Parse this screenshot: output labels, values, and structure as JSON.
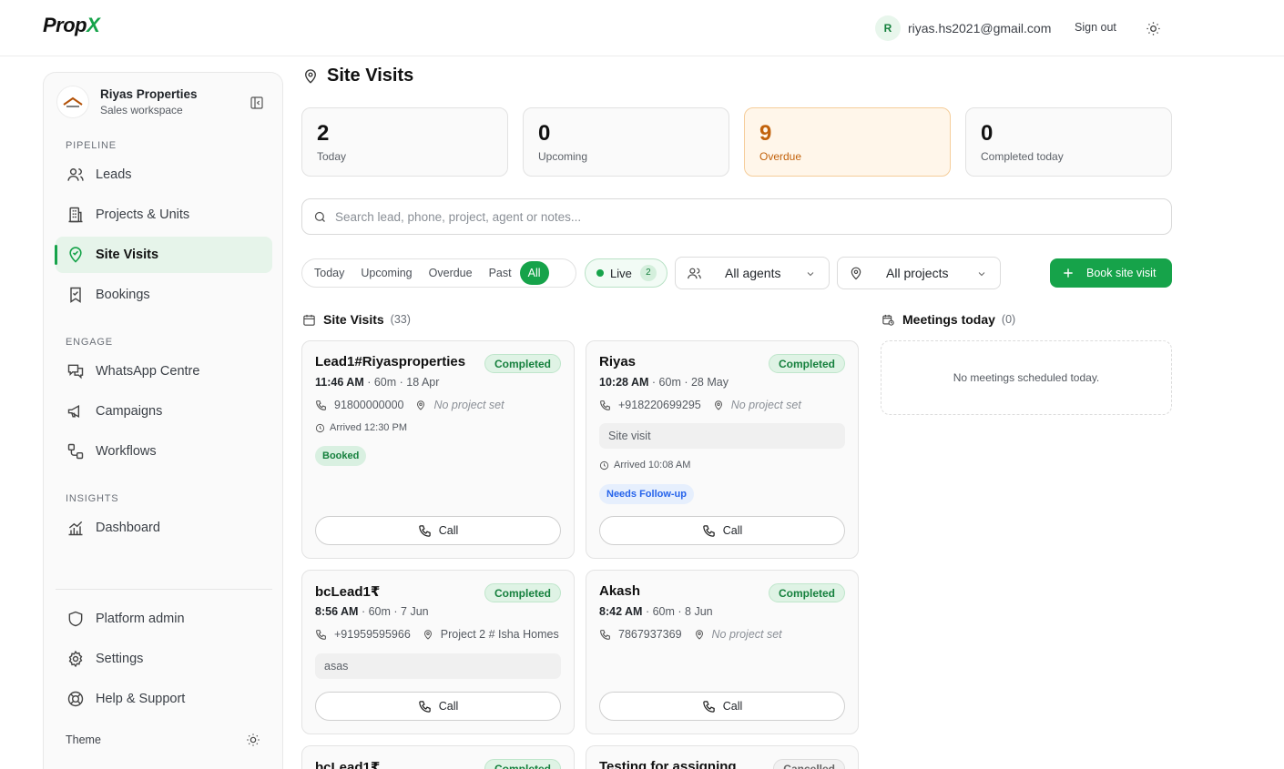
{
  "brand": {
    "name_main": "Prop",
    "name_accent": "X"
  },
  "header": {
    "avatar_initial": "R",
    "email": "riyas.hs2021@gmail.com",
    "signout_label": "Sign out"
  },
  "workspace": {
    "name": "Riyas Properties",
    "subtitle": "Sales workspace"
  },
  "sidebar": {
    "sections": [
      "PIPELINE",
      "ENGAGE",
      "INSIGHTS"
    ],
    "items": [
      {
        "label": "Leads"
      },
      {
        "label": "Projects & Units"
      },
      {
        "label": "Site Visits"
      },
      {
        "label": "Bookings"
      },
      {
        "label": "WhatsApp Centre"
      },
      {
        "label": "Campaigns"
      },
      {
        "label": "Workflows"
      },
      {
        "label": "Dashboard"
      },
      {
        "label": "Platform admin"
      },
      {
        "label": "Settings"
      },
      {
        "label": "Help & Support"
      }
    ],
    "active_item": "Site Visits",
    "theme_label": "Theme"
  },
  "page": {
    "title": "Site Visits"
  },
  "stats": [
    {
      "value": "2",
      "label": "Today"
    },
    {
      "value": "0",
      "label": "Upcoming"
    },
    {
      "value": "9",
      "label": "Overdue"
    },
    {
      "value": "0",
      "label": "Completed today"
    }
  ],
  "search": {
    "placeholder": "Search lead, phone, project, agent or notes...",
    "value": ""
  },
  "filters": {
    "tabs": [
      "Today",
      "Upcoming",
      "Overdue",
      "Past",
      "All"
    ],
    "selected": "All",
    "live_label": "Live",
    "live_count": "2",
    "agents_select": "All agents",
    "projects_select": "All projects",
    "book_label": "Book site visit"
  },
  "list": {
    "title": "Site Visits",
    "count": "(33)"
  },
  "visits": [
    {
      "name": "Lead1#Riyasproperties",
      "status": "Completed",
      "time": "11:46 AM",
      "meta": "· 60m · 18 Apr",
      "phone": "91800000000",
      "project": "No project set",
      "note": "",
      "arrived": "Arrived 12:30 PM",
      "tag": "Booked",
      "call_label": "Call"
    },
    {
      "name": "Riyas",
      "status": "Completed",
      "time": "10:28 AM",
      "meta": "· 60m · 28 May",
      "phone": "+918220699295",
      "project": "No project set",
      "note": "Site visit",
      "arrived": "Arrived 10:08 AM",
      "tag": "Needs Follow-up",
      "call_label": "Call"
    },
    {
      "name": "bcLead1₹",
      "status": "Completed",
      "time": "8:56 AM",
      "meta": "· 60m · 7 Jun",
      "phone": "+91959595966",
      "project": "Project 2 # Isha Homes",
      "note": "asas",
      "arrived": "",
      "tag": "",
      "call_label": "Call"
    },
    {
      "name": "Akash",
      "status": "Completed",
      "time": "8:42 AM",
      "meta": "· 60m · 8 Jun",
      "phone": "7867937369",
      "project": "No project set",
      "note": "",
      "arrived": "",
      "tag": "",
      "call_label": "Call"
    },
    {
      "name": "bcLead1₹",
      "status": "Completed"
    },
    {
      "name": "Testing for assigning",
      "status": "Cancelled"
    }
  ],
  "meetings": {
    "title": "Meetings today",
    "count": "(0)",
    "empty_text": "No meetings scheduled today."
  },
  "colors": {
    "accent": "#16a34a",
    "overdue": "#c2620c",
    "tag_blue": "#2563eb"
  }
}
